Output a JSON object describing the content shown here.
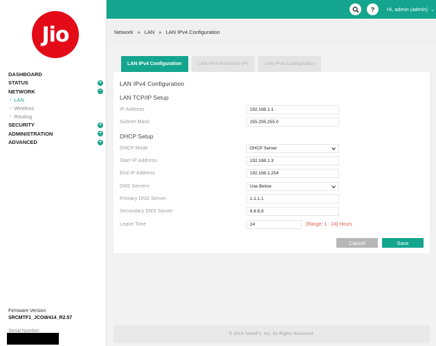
{
  "brand": {
    "logo_text": "Jio",
    "accent": "#14a58e",
    "logo_color": "#e30b17"
  },
  "sidebar": {
    "items": [
      {
        "label": "DASHBOARD",
        "toggle": ""
      },
      {
        "label": "STATUS",
        "toggle": "+"
      },
      {
        "label": "NETWORK",
        "toggle": "−"
      }
    ],
    "network_sub": [
      {
        "label": "LAN"
      },
      {
        "label": "Wireless"
      },
      {
        "label": "Routing"
      }
    ],
    "items_after": [
      {
        "label": "SECURITY",
        "toggle": "+"
      },
      {
        "label": "ADMINISTRATION",
        "toggle": "+"
      },
      {
        "label": "ADVANCED",
        "toggle": "+"
      }
    ],
    "firmware_label": "Firmware Version",
    "firmware_value": "SRCMTF1_JCOW414_R2.57",
    "serial_label": "Serial Number"
  },
  "header": {
    "search_icon": "search-icon",
    "help_glyph": "?",
    "user_label": "Hi, admin (admin)",
    "user_chevron": "⌄"
  },
  "breadcrumb": [
    "Network",
    "LAN",
    "LAN IPv4 Configuration"
  ],
  "breadcrumb_sep": "»",
  "tabs": [
    {
      "label": "LAN IPv4 Configuration",
      "active": true
    },
    {
      "label": "LAN IPv4 Reserved IPs",
      "active": false
    },
    {
      "label": "LAN IPv6 Configuration",
      "active": false
    }
  ],
  "panel": {
    "title": "LAN IPv4 Configuration",
    "tcpip_heading": "LAN TCP/IP Setup",
    "ip_label": "IP Address",
    "ip_value": "192.168.1.1",
    "mask_label": "Subnet Mask",
    "mask_value": "255.255.255.0",
    "dhcp_heading": "DHCP Setup",
    "dhcp_mode_label": "DHCP Mode",
    "dhcp_mode_value": "DHCP Server",
    "start_label": "Start IP Address",
    "start_value": "192.168.1.3",
    "end_label": "End IP Address",
    "end_value": "192.168.1.254",
    "dns_label": "DNS Servers",
    "dns_value": "Use Below",
    "primary_label": "Primary DNS Server",
    "primary_value": "1.1.1.1",
    "secondary_label": "Secondary DNS Server",
    "secondary_value": "8.8.8.8",
    "lease_label": "Lease Time",
    "lease_value": "24",
    "lease_range": "[Range: 1 - 24] Hours",
    "cancel_label": "Cancel",
    "save_label": "Save"
  },
  "footer": {
    "copyright": "© 2019 TeamF1, Inc. All Rights Reserved."
  }
}
